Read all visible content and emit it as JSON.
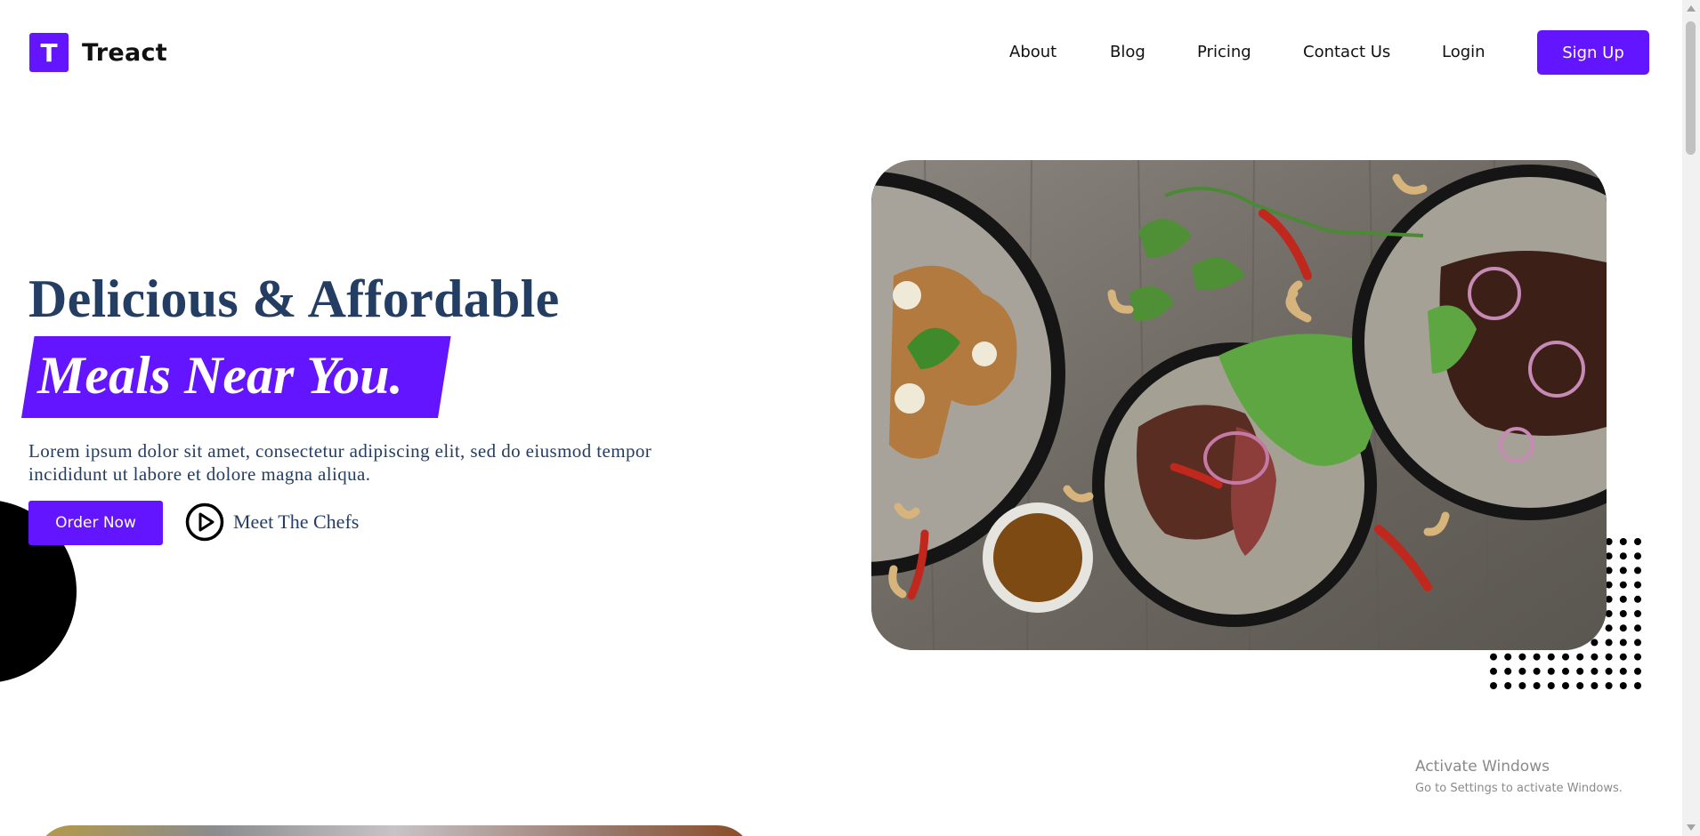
{
  "header": {
    "logo_letter": "T",
    "logo_text": "Treact",
    "nav": [
      "About",
      "Blog",
      "Pricing",
      "Contact Us",
      "Login"
    ],
    "signup": "Sign Up"
  },
  "hero": {
    "heading_line1": "Delicious & Affordable",
    "heading_highlight": "Meals Near You.",
    "description": "Lorem ipsum dolor sit amet, consectetur adipiscing elit, sed do eiusmod tempor incididunt ut labore et dolore magna aliqua.",
    "order_button": "Order Now",
    "chefs_link": "Meet The Chefs"
  },
  "watermark": {
    "title": "Activate Windows",
    "subtitle": "Go to Settings to activate Windows."
  },
  "icons": {
    "play": "play-circle-icon",
    "dots": "dot-pattern-icon"
  },
  "colors": {
    "accent": "#6415ff",
    "heading": "#243e63"
  }
}
